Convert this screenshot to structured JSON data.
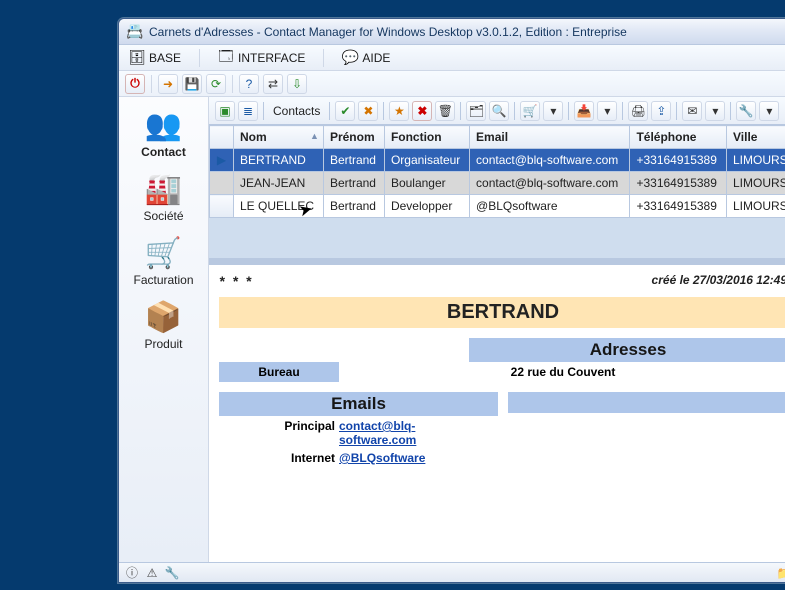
{
  "window": {
    "title": "Carnets d'Adresses - Contact Manager for Windows Desktop v3.0.1.2, Edition : Entreprise",
    "app_icon": "address-book-icon"
  },
  "menu": {
    "base": {
      "label": "BASE",
      "icon": "database-icon"
    },
    "interface": {
      "label": "INTERFACE",
      "icon": "window-icon"
    },
    "aide": {
      "label": "AIDE",
      "icon": "help-icon"
    }
  },
  "small_toolbar": {
    "items": [
      {
        "name": "power-icon",
        "glyph": "⏻",
        "cls": "red"
      },
      {
        "name": "login-icon",
        "glyph": "➜",
        "cls": "orange"
      },
      {
        "name": "save-icon",
        "glyph": "💾",
        "cls": "blue"
      },
      {
        "name": "refresh-icon",
        "glyph": "⟳",
        "cls": "green"
      },
      {
        "name": "help2-icon",
        "glyph": "?",
        "cls": "blue"
      },
      {
        "name": "sync-icon",
        "glyph": "⇄",
        "cls": "dark"
      },
      {
        "name": "download-icon",
        "glyph": "⇩",
        "cls": "green"
      }
    ]
  },
  "sidebar": {
    "items": [
      {
        "name": "contact",
        "label": "Contact",
        "icon": "team-icon",
        "glyph": "👥",
        "active": true
      },
      {
        "name": "societe",
        "label": "Société",
        "icon": "factory-icon",
        "glyph": "🏭",
        "active": false
      },
      {
        "name": "facturation",
        "label": "Facturation",
        "icon": "cart-icon",
        "glyph": "🛒",
        "active": false
      },
      {
        "name": "produit",
        "label": "Produit",
        "icon": "package-icon",
        "glyph": "📦",
        "active": false
      }
    ]
  },
  "secondary_toolbar": {
    "leading": [
      {
        "name": "collapse-icon",
        "glyph": "▣",
        "cls": "green"
      },
      {
        "name": "tree-icon",
        "glyph": "≣",
        "cls": "blue"
      }
    ],
    "label": "Contacts",
    "groups": [
      [
        {
          "name": "check-icon",
          "glyph": "✔",
          "cls": "green"
        },
        {
          "name": "uncheck-icon",
          "glyph": "✖",
          "cls": "orange"
        }
      ],
      [
        {
          "name": "star-icon",
          "glyph": "★",
          "cls": "orange"
        },
        {
          "name": "delete-icon",
          "glyph": "✖",
          "cls": "red"
        },
        {
          "name": "trash-icon",
          "glyph": "🗑",
          "cls": "dark"
        }
      ],
      [
        {
          "name": "card-icon",
          "glyph": "🗂",
          "cls": "dark"
        },
        {
          "name": "find-icon",
          "glyph": "🔍",
          "cls": "dark"
        }
      ],
      [
        {
          "name": "cart2-icon",
          "glyph": "🛒",
          "cls": "green"
        },
        {
          "name": "more1-icon",
          "glyph": "▾",
          "cls": "dark"
        }
      ],
      [
        {
          "name": "inbox-icon",
          "glyph": "📥",
          "cls": "dark"
        },
        {
          "name": "more2-icon",
          "glyph": "▾",
          "cls": "dark"
        }
      ],
      [
        {
          "name": "print-icon",
          "glyph": "🖨",
          "cls": "dark"
        },
        {
          "name": "export-icon",
          "glyph": "⇪",
          "cls": "blue"
        }
      ],
      [
        {
          "name": "mail-icon",
          "glyph": "✉",
          "cls": "dark"
        },
        {
          "name": "more3-icon",
          "glyph": "▾",
          "cls": "dark"
        }
      ],
      [
        {
          "name": "tool-icon",
          "glyph": "🔧",
          "cls": "blue"
        },
        {
          "name": "more4-icon",
          "glyph": "▾",
          "cls": "dark"
        }
      ]
    ]
  },
  "grid": {
    "columns": [
      {
        "key": "nom",
        "label": "Nom",
        "sorted": true
      },
      {
        "key": "prenom",
        "label": "Prénom"
      },
      {
        "key": "fonction",
        "label": "Fonction"
      },
      {
        "key": "email",
        "label": "Email"
      },
      {
        "key": "telephone",
        "label": "Téléphone"
      },
      {
        "key": "ville",
        "label": "Ville"
      }
    ],
    "rows": [
      {
        "nom": "BERTRAND",
        "prenom": "Bertrand",
        "fonction": "Organisateur",
        "email": "contact@blq-software.com",
        "telephone": "+33164915389",
        "ville": "LIMOURS",
        "selected": true
      },
      {
        "nom": "JEAN-JEAN",
        "prenom": "Bertrand",
        "fonction": "Boulanger",
        "email": "contact@blq-software.com",
        "telephone": "+33164915389",
        "ville": "LIMOURS",
        "alt": true
      },
      {
        "nom": "LE QUELLEC",
        "prenom": "Bertrand",
        "fonction": "Developper",
        "email": "@BLQsoftware",
        "telephone": "+33164915389",
        "ville": "LIMOURS"
      }
    ]
  },
  "detail": {
    "stars": "* * *",
    "created": "créé le 27/03/2016 12:49",
    "big_name": "BERTRAND",
    "sections": {
      "addresses": {
        "title": "Adresses",
        "row": {
          "label": "Bureau",
          "value": "22 rue du Couvent"
        }
      },
      "emails": {
        "title": "Emails",
        "rows": [
          {
            "label": "Principal",
            "value": "contact@blq-software.com"
          },
          {
            "label": "Internet",
            "value": "@BLQsoftware"
          }
        ]
      }
    }
  },
  "status": {
    "left_icons": [
      {
        "name": "info-icon",
        "glyph": "ⓘ"
      },
      {
        "name": "warn-icon",
        "glyph": "⚠"
      },
      {
        "name": "wrench-icon",
        "glyph": "🔧"
      }
    ],
    "right_icon": {
      "name": "folder-icon",
      "glyph": "📁"
    }
  },
  "colors": {
    "window_frame": "#3b5b8a",
    "desktop_bg": "#053a6e",
    "selection": "#2f62b5",
    "header_band": "#aec6ea",
    "name_band": "#ffe5b4"
  }
}
